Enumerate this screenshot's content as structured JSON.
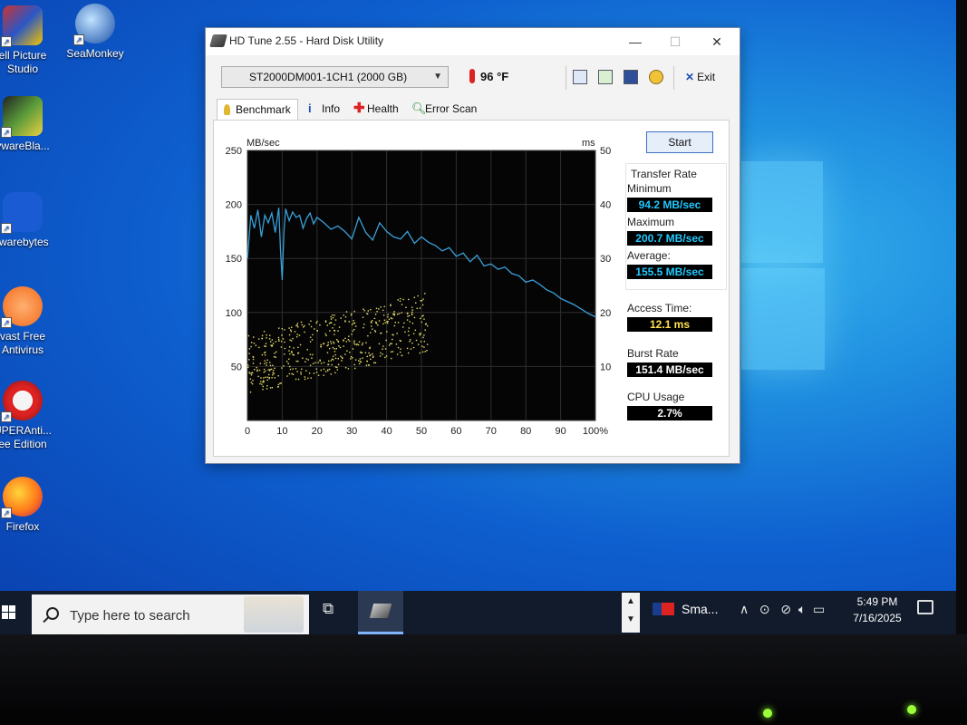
{
  "window": {
    "title": "HD Tune 2.55 - Hard Disk Utility",
    "minimize": "—",
    "maximize": "☐",
    "close": "✕"
  },
  "toolbar": {
    "drive": "ST2000DM001-1CH1 (2000 GB)",
    "temperature": "96 °F",
    "exit_label": "Exit"
  },
  "tabs": [
    {
      "label": "Benchmark",
      "active": true
    },
    {
      "label": "Info"
    },
    {
      "label": "Health"
    },
    {
      "label": "Error Scan"
    }
  ],
  "benchmark": {
    "start_label": "Start",
    "transfer_rate_label": "Transfer Rate",
    "minimum_label": "Minimum",
    "minimum_value": "94.2 MB/sec",
    "maximum_label": "Maximum",
    "maximum_value": "200.7 MB/sec",
    "average_label": "Average",
    "average_value": "155.5 MB/sec",
    "access_time_label": "Access Time",
    "access_time_value": "12.1 ms",
    "burst_rate_label": "Burst Rate",
    "burst_rate_value": "151.4 MB/sec",
    "cpu_usage_label": "CPU Usage",
    "cpu_usage_value": "2.7%"
  },
  "chart_data": {
    "type": "line",
    "ylabel_left": "MB/sec",
    "ylabel_right": "ms",
    "x_ticks": [
      "0",
      "10",
      "20",
      "30",
      "40",
      "50",
      "60",
      "70",
      "80",
      "90",
      "100%"
    ],
    "y_left_ticks": [
      "250",
      "200",
      "150",
      "100",
      "50"
    ],
    "y_right_ticks": [
      "50",
      "40",
      "30",
      "20",
      "10"
    ],
    "xlim": [
      0,
      100
    ],
    "ylim_left": [
      0,
      250
    ],
    "ylim_right": [
      0,
      50
    ],
    "grid": true,
    "transfer_rate_series": {
      "x": [
        0,
        1,
        2,
        3,
        4,
        5,
        6,
        7,
        8,
        9,
        9.5,
        10,
        10.5,
        11,
        12,
        13,
        14,
        15,
        16,
        17,
        18,
        19,
        20,
        22,
        24,
        26,
        28,
        30,
        32,
        34,
        36,
        38,
        40,
        42,
        44,
        46,
        48,
        50,
        52,
        54,
        56,
        58,
        60,
        62,
        64,
        66,
        68,
        70,
        72,
        74,
        76,
        78,
        80,
        82,
        84,
        86,
        88,
        90,
        92,
        94,
        96,
        98,
        100
      ],
      "y": [
        150,
        190,
        178,
        195,
        170,
        190,
        183,
        192,
        174,
        197,
        158,
        130,
        175,
        196,
        185,
        193,
        188,
        190,
        178,
        187,
        192,
        182,
        188,
        183,
        177,
        180,
        175,
        168,
        188,
        174,
        167,
        183,
        175,
        170,
        168,
        175,
        164,
        170,
        165,
        162,
        157,
        160,
        152,
        155,
        147,
        153,
        143,
        145,
        140,
        142,
        136,
        134,
        128,
        130,
        126,
        121,
        118,
        113,
        110,
        107,
        103,
        99,
        96
      ]
    },
    "access_time_scatter": {
      "x_range": [
        0,
        52
      ],
      "ms_low_start": 5,
      "ms_low_end": 13,
      "ms_high_start": 16,
      "ms_high_end": 24
    }
  },
  "desktop_icons": [
    {
      "line1": "ell Picture",
      "line2": "Studio"
    },
    {
      "line1": "SeaMonkey",
      "line2": ""
    },
    {
      "line1": "ywareBla...",
      "line2": ""
    },
    {
      "line1": "lwarebytes",
      "line2": ""
    },
    {
      "line1": "vast Free",
      "line2": "Antivirus"
    },
    {
      "line1": "UPERAnti...",
      "line2": "ee Edition"
    },
    {
      "line1": "Firefox",
      "line2": ""
    }
  ],
  "taskbar": {
    "search_placeholder": "Type here to search",
    "widget_label": "Sma...",
    "time": "5:49 PM",
    "date": "7/16/2025"
  }
}
